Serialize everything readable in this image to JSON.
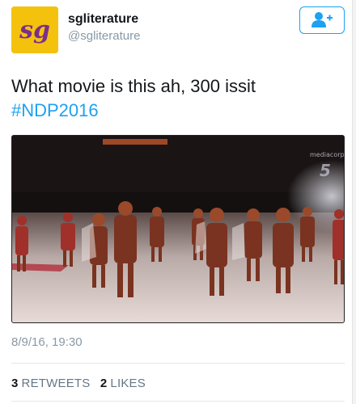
{
  "profile": {
    "avatar_text": "sg",
    "display_name": "sgliterature",
    "handle": "@sgliterature"
  },
  "follow_button": {
    "icon": "add-user-icon"
  },
  "tweet": {
    "text_line1": "What movie is this ah, 300 issit",
    "hashtag": "#NDP2016"
  },
  "media": {
    "watermark": "mediacorp 5",
    "description_icon": "video-frame"
  },
  "timestamp": "8/9/16, 19:30",
  "stats": {
    "retweets_count": "3",
    "retweets_label": "RETWEETS",
    "likes_count": "2",
    "likes_label": "LIKES"
  },
  "colors": {
    "accent": "#1da1f2",
    "avatar_bg": "#f4c20d",
    "avatar_text": "#7b2f8a",
    "muted": "#8899a6"
  }
}
